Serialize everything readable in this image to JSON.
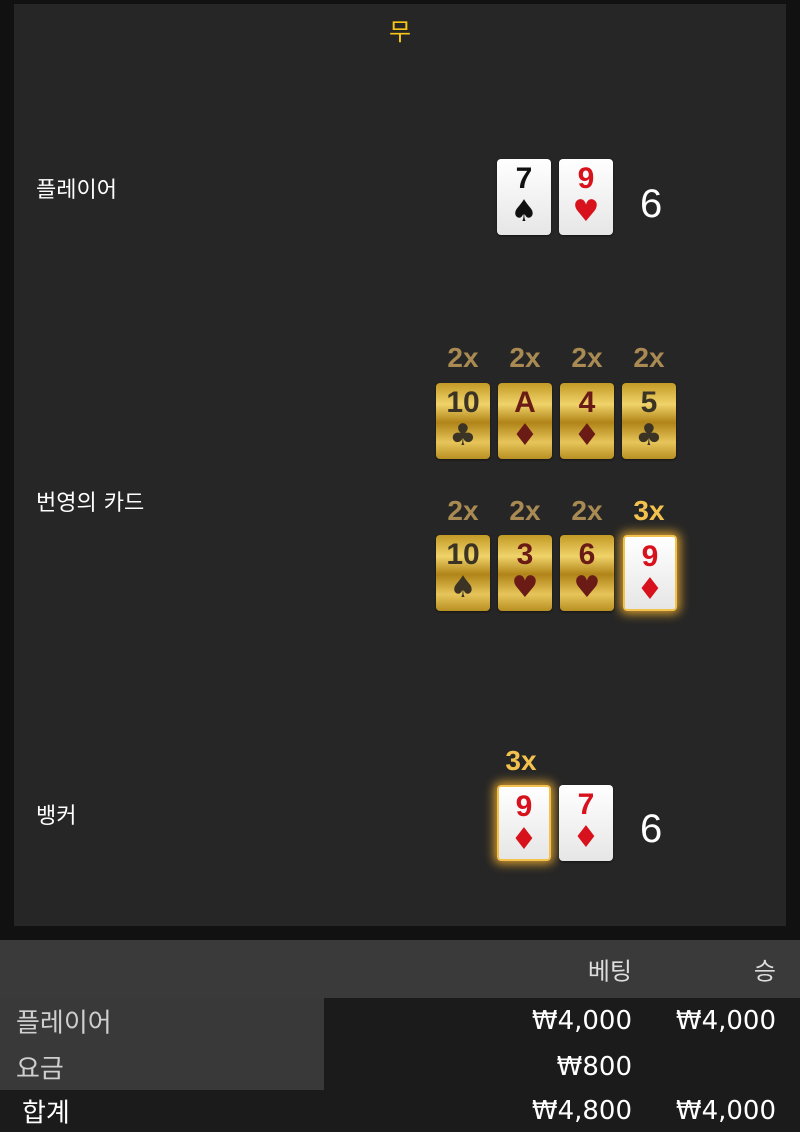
{
  "result": {
    "label": "무"
  },
  "rows": {
    "player_label": "플레이어",
    "blessed_label": "번영의 카드",
    "banker_label": "뱅커"
  },
  "player": {
    "score": "6",
    "cards": [
      {
        "rank": "7",
        "suit": "♠",
        "color": "black"
      },
      {
        "rank": "9",
        "suit": "♥",
        "color": "red"
      }
    ]
  },
  "banker": {
    "score": "6",
    "multiplier": "3x",
    "cards": [
      {
        "rank": "9",
        "suit": "♦",
        "color": "red"
      },
      {
        "rank": "7",
        "suit": "♦",
        "color": "red"
      }
    ]
  },
  "blessed": {
    "row1": [
      {
        "mult": "2x",
        "rank": "10",
        "suit": "♣",
        "color": "black"
      },
      {
        "mult": "2x",
        "rank": "A",
        "suit": "♦",
        "color": "red"
      },
      {
        "mult": "2x",
        "rank": "4",
        "suit": "♦",
        "color": "red"
      },
      {
        "mult": "2x",
        "rank": "5",
        "suit": "♣",
        "color": "black"
      }
    ],
    "row2": [
      {
        "mult": "2x",
        "rank": "10",
        "suit": "♠",
        "color": "black"
      },
      {
        "mult": "2x",
        "rank": "3",
        "suit": "♥",
        "color": "red"
      },
      {
        "mult": "2x",
        "rank": "6",
        "suit": "♥",
        "color": "red"
      },
      {
        "mult": "3x",
        "rank": "9",
        "suit": "♦",
        "color": "red"
      }
    ]
  },
  "table": {
    "header": {
      "bet": "베팅",
      "win": "승"
    },
    "rows": [
      {
        "label": "플레이어",
        "bet": "₩4,000",
        "win": "₩4,000"
      },
      {
        "label": "요금",
        "bet": "₩800",
        "win": ""
      },
      {
        "label": "합계",
        "bet": "₩4,800",
        "win": "₩4,000"
      }
    ]
  },
  "colors": {
    "result": "#f5c518",
    "red_suit": "#d8121d",
    "gold_highlight": "#f2c14e"
  }
}
